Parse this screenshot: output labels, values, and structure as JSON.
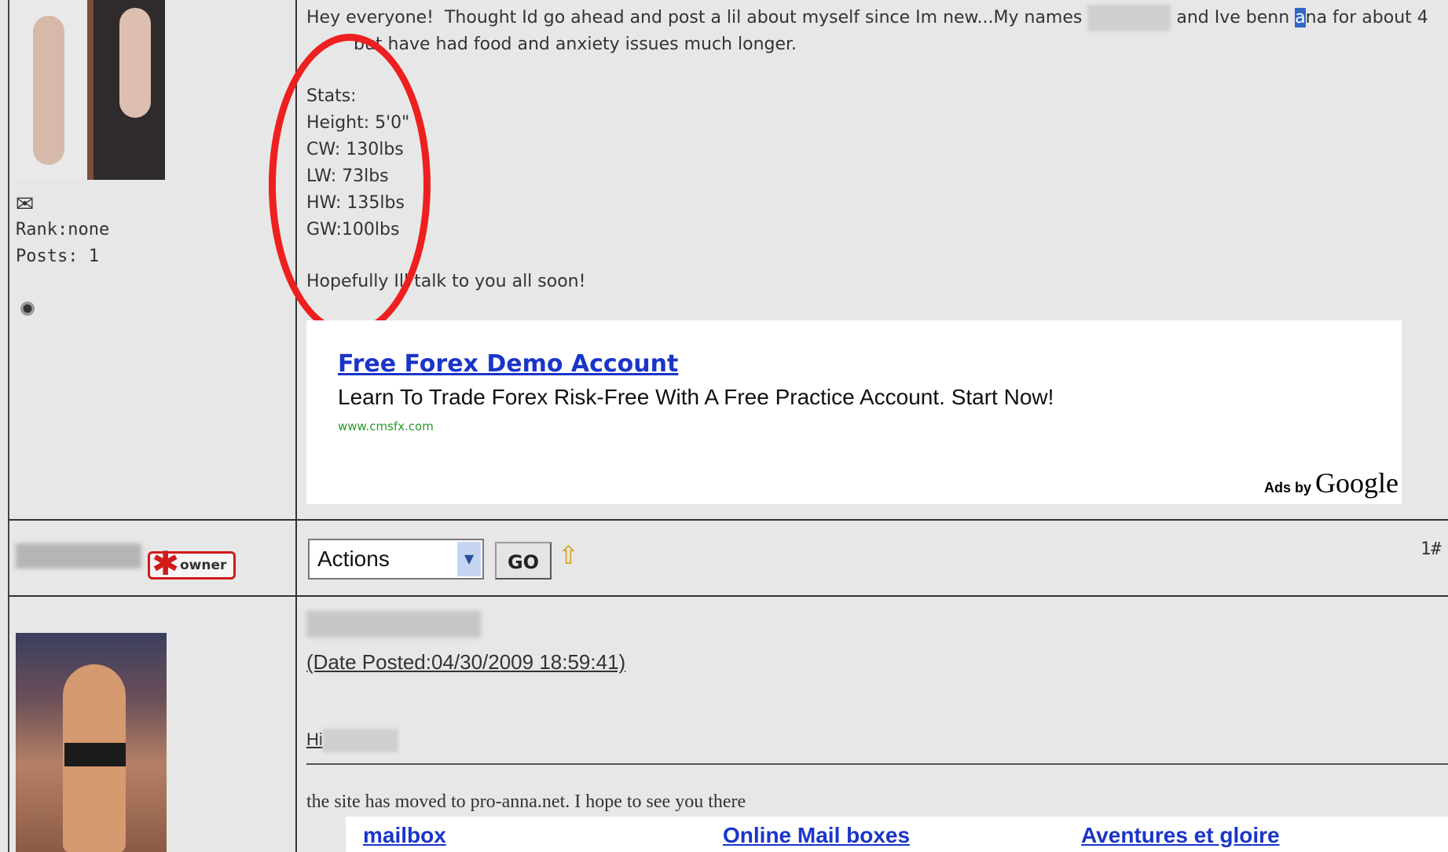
{
  "user1": {
    "rank": "Rank:none",
    "posts": "Posts: 1"
  },
  "post1": {
    "line1_before": "Hey everyone!  Thought Id go ahead and post a lil about myself since Im new...My names ",
    "line1_after": " and Ive benn ",
    "line1_highlight": "a",
    "line1_end": "na for about 4",
    "line2_visible": "but have had food and anxiety issues much longer.",
    "stats_label": "Stats:",
    "height": "Height: 5'0\"",
    "cw": "CW: 130lbs",
    "lw": "LW: 73lbs",
    "hw": "HW: 135lbs",
    "gw": "GW:100lbs",
    "closing": "Hopefully Ill talk to you all soon!"
  },
  "ad": {
    "title": "Free Forex Demo Account",
    "description": "Learn To Trade Forex Risk-Free With A Free Practice Account. Start Now!",
    "url": "www.cmsfx.com",
    "ads_by": "Ads by ",
    "ads_brand": "Google"
  },
  "action_bar": {
    "owner_badge": "owner",
    "actions_select": "Actions",
    "go_button": "GO",
    "post_number": "1#"
  },
  "post2": {
    "date_posted": "(Date Posted:04/30/2009 18:59:41)",
    "greeting": "Hi",
    "body": "the site has moved to pro-anna.net. I hope to see you there",
    "links": [
      "mailbox",
      "Online Mail boxes",
      "Aventures et gloire"
    ]
  },
  "colors": {
    "annotation_red": "#ee1f1f",
    "link_blue": "#1a35c8",
    "ad_url_green": "#2a9a2a"
  }
}
